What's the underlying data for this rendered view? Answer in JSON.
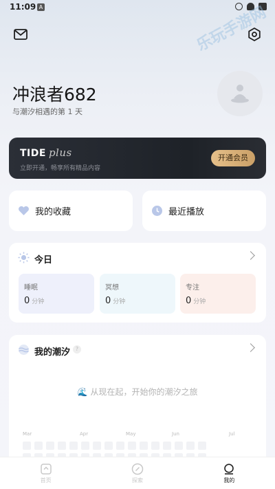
{
  "status_bar": {
    "time": "11:09",
    "notif": "A"
  },
  "watermark": "乐玩手游网",
  "profile": {
    "username": "冲浪者682",
    "subtitle": "与潮汐相遇的第 1 天"
  },
  "vip": {
    "brand": "TIDE",
    "plus": "plus",
    "description": "立即开通，畅享所有精品内容",
    "button_label": "开通会员"
  },
  "quick_links": {
    "favorites": "我的收藏",
    "recent": "最近播放"
  },
  "today": {
    "title": "今日",
    "stats": [
      {
        "label": "睡眠",
        "value": "0",
        "unit": "分钟"
      },
      {
        "label": "冥想",
        "value": "0",
        "unit": "分钟"
      },
      {
        "label": "专注",
        "value": "0",
        "unit": "分钟"
      }
    ]
  },
  "my_tide": {
    "title": "我的潮汐",
    "empty_message": "从现在起，开始你的潮汐之旅",
    "months": [
      "Mar",
      "Apr",
      "May",
      "Jun",
      "Jul"
    ]
  },
  "tabbar": {
    "tabs": [
      {
        "label": "首页",
        "icon": "home-icon"
      },
      {
        "label": "探索",
        "icon": "compass-icon"
      },
      {
        "label": "我的",
        "icon": "profile-icon"
      }
    ],
    "active": "我的"
  },
  "colors": {
    "vip_gold": "#caa067",
    "sleep_bg": "#eef0fb",
    "meditate_bg": "#eef7fb",
    "focus_bg": "#fcefeb"
  }
}
